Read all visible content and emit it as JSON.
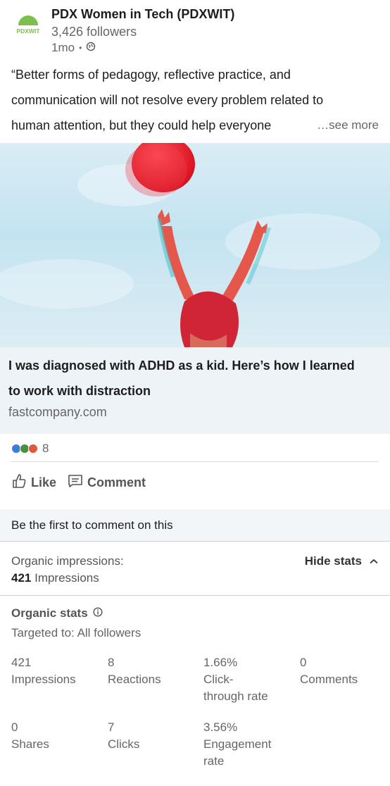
{
  "post": {
    "org_name": "PDX Women in Tech (PDXWIT)",
    "logo_text": "PDXWIT",
    "followers": "3,426 followers",
    "time": "1mo",
    "text_lines": [
      "“Better forms of pedagogy, reflective practice, and",
      "communication will not resolve every problem related to",
      "human attention, but they could help everyone"
    ],
    "see_more": "…see more"
  },
  "link_card": {
    "title_lines": [
      "I was diagnosed with ADHD as a kid. Here’s how I learned",
      "to work with distraction"
    ],
    "domain": "fastcompany.com"
  },
  "social": {
    "reaction_count": "8",
    "like_label": "Like",
    "comment_label": "Comment",
    "first_comment_prompt": "Be the first to comment on this"
  },
  "impressions": {
    "label": "Organic impressions:",
    "value": "421",
    "unit": " Impressions",
    "toggle_label": "Hide stats"
  },
  "stats": {
    "title": "Organic stats",
    "targeted": "Targeted to: All followers",
    "items": [
      {
        "value": "421",
        "label": "Impressions"
      },
      {
        "value": "8",
        "label": "Reactions"
      },
      {
        "value": "1.66%",
        "label_l1": "Click-",
        "label_l2": "through rate"
      },
      {
        "value": "0",
        "label": "Comments"
      },
      {
        "value": "0",
        "label": "Shares"
      },
      {
        "value": "7",
        "label": "Clicks"
      },
      {
        "value": "3.56%",
        "label_l1": "Engagement",
        "label_l2": "rate"
      }
    ]
  },
  "colors": {
    "brand_green": "#7cc04b",
    "link_card_bg": "#eef3f8",
    "balloon_red": "#e81f2a"
  },
  "icons": [
    "pdxwit-logo",
    "globe-icon",
    "reaction-icons",
    "thumbs-up-icon",
    "comment-icon",
    "chevron-up-icon",
    "info-icon"
  ]
}
